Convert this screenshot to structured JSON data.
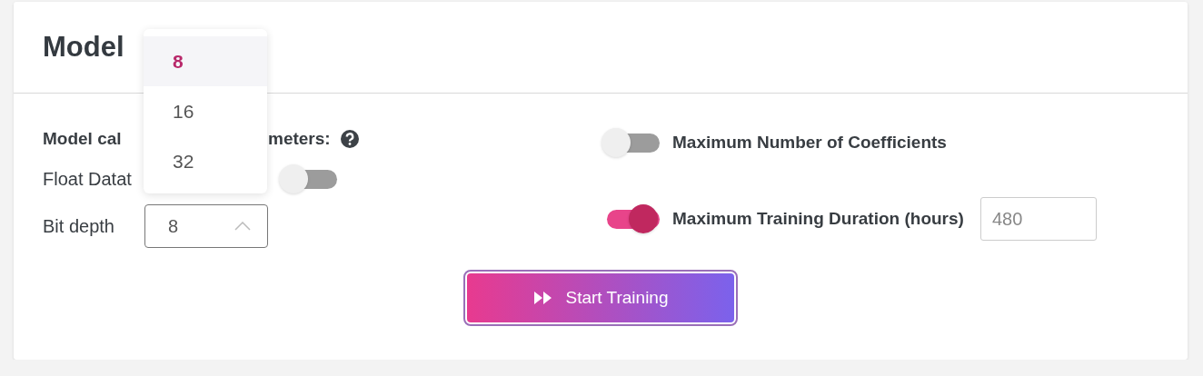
{
  "panel": {
    "title": "Model",
    "calc_label": {
      "before": "Model cal",
      "after": "meters:"
    },
    "float_datatype": {
      "label": "Float Datat",
      "on": false
    },
    "bit_depth": {
      "label": "Bit depth",
      "value": "8",
      "expanded": true,
      "options": [
        {
          "label": "8",
          "selected": true
        },
        {
          "label": "16",
          "selected": false
        },
        {
          "label": "32",
          "selected": false
        }
      ]
    },
    "max_coefficients": {
      "label": "Maximum Number of Coefficients",
      "on": false
    },
    "max_training_duration": {
      "label": "Maximum Training Duration (hours)",
      "on": true,
      "placeholder": "480"
    },
    "start_button": {
      "label": "Start Training"
    }
  }
}
